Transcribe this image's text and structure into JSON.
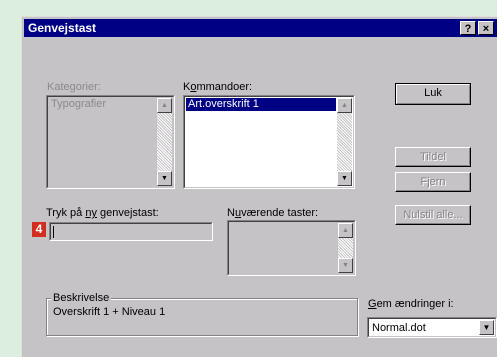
{
  "window": {
    "title": "Genvejstast",
    "help_button": "?",
    "close_button": "×"
  },
  "categories": {
    "label": "Kategorier:",
    "items": [
      "Typografier"
    ]
  },
  "commands": {
    "label_pre": "K",
    "label_ul": "o",
    "label_post": "mmandoer:",
    "items": [
      "Art.overskrift 1"
    ]
  },
  "new_shortcut": {
    "label_pre": "Tryk på ",
    "label_ul": "ny",
    "label_post": " genvejstast:",
    "value": ""
  },
  "current_keys": {
    "label_pre": "N",
    "label_ul": "u",
    "label_post": "værende taster:"
  },
  "buttons": {
    "close": "Luk",
    "assign": "Tildel",
    "remove": "Fjern",
    "reset_all": "Nulstil alle..."
  },
  "description": {
    "caption": "Beskrivelse",
    "text": "Overskrift 1 + Niveau 1"
  },
  "save_changes": {
    "label_ul": "G",
    "label_post": "em ændringer i:",
    "selected": "Normal.dot"
  },
  "annotation": {
    "badge": "4",
    "color": "#d22d1e"
  },
  "colors": {
    "titlebar": "#000084",
    "dialog": "#c6c3c6",
    "selection": "#000084"
  }
}
